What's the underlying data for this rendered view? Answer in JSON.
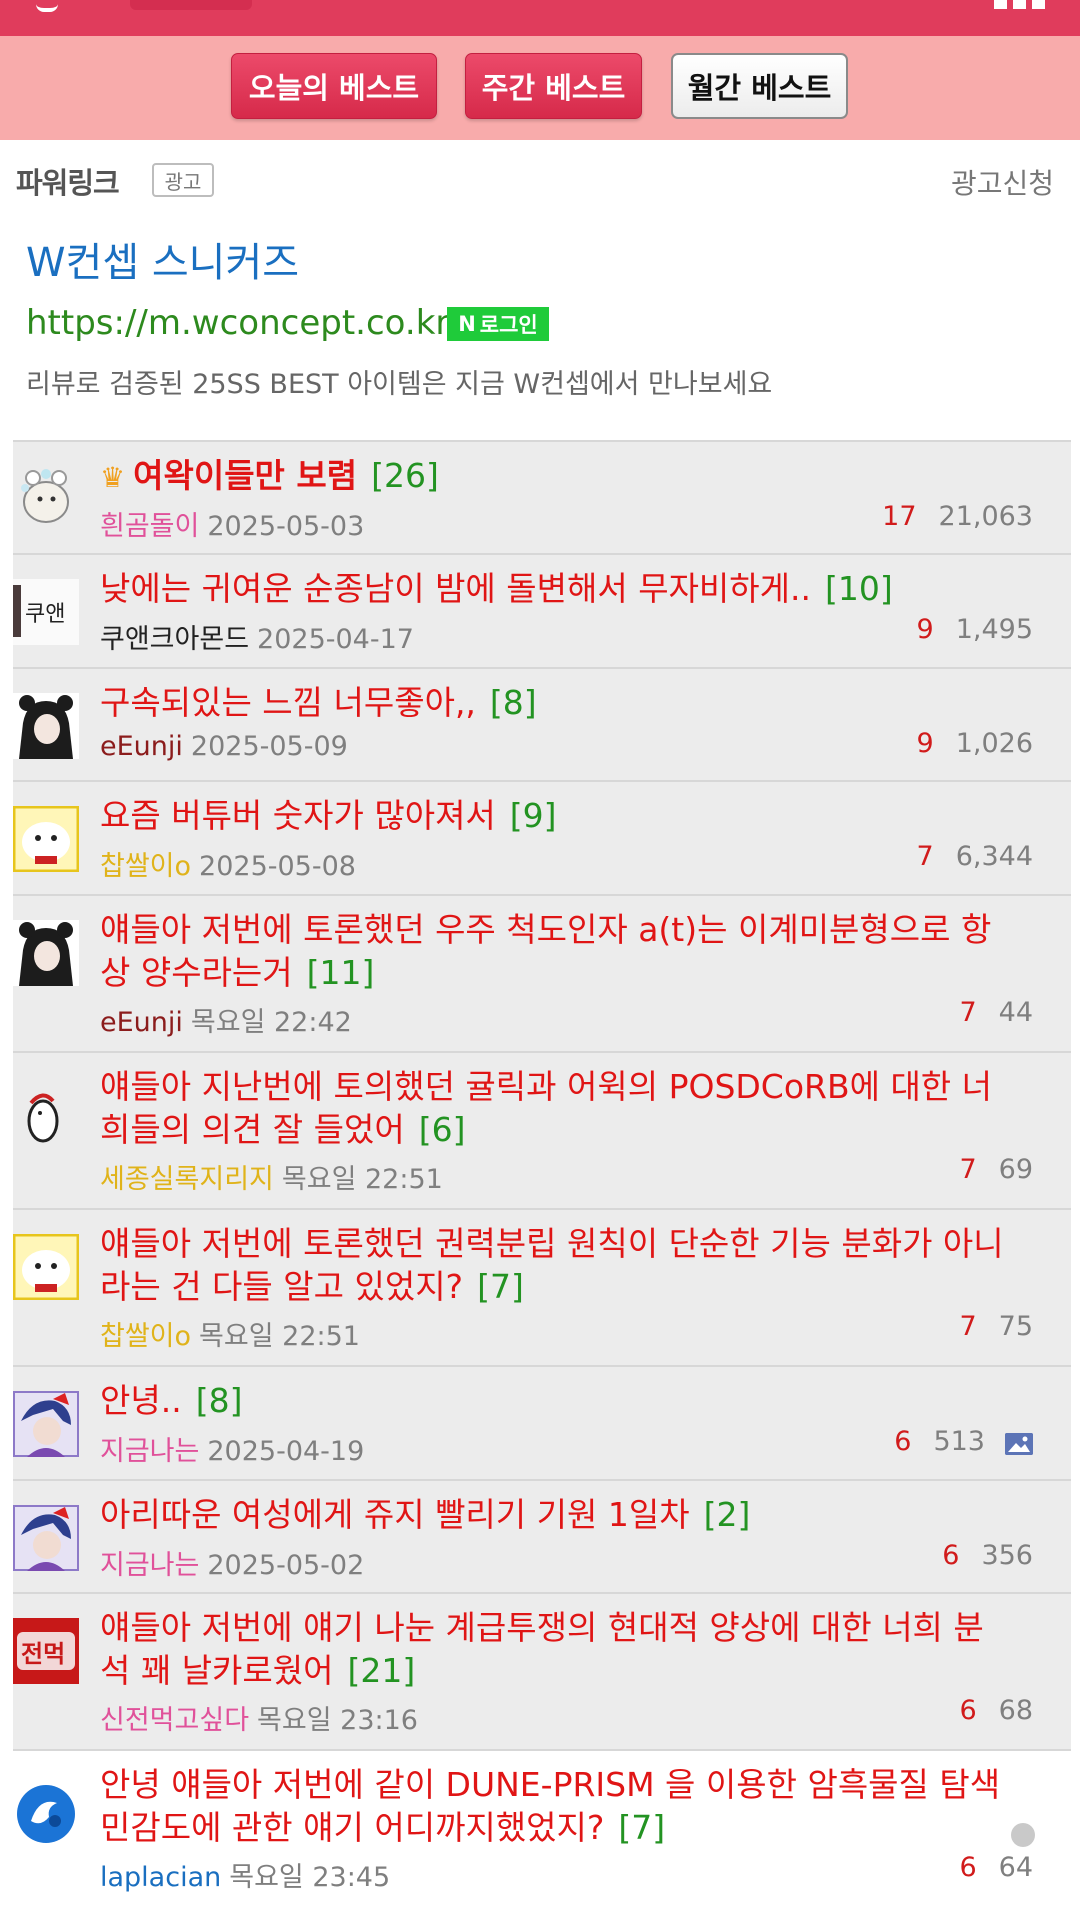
{
  "best_tabs": [
    {
      "label": "오늘의 베스트",
      "active": false
    },
    {
      "label": "주간 베스트",
      "active": false
    },
    {
      "label": "월간 베스트",
      "active": true
    }
  ],
  "ad": {
    "section_label": "파워링크",
    "badge": "광고",
    "apply": "광고신청",
    "title": "W컨셉 스니커즈",
    "url": "https://m.wconcept.co.kr",
    "login_badge": "로그인",
    "login_badge_letter": "N",
    "description": "리뷰로 검증된 25SS BEST 아이템은 지금 W컨셉에서 만나보세요"
  },
  "posts": [
    {
      "title": "여왁이들만 보렴",
      "comments": "[26]",
      "author": "흰곰돌이",
      "author_color": "#e0519a",
      "date": "2025-05-03",
      "votes": "17",
      "views": "21,063",
      "crown": true
    },
    {
      "title": "낮에는 귀여운 순종남이 밤에 돌변해서 무자비하게..",
      "comments": "[10]",
      "author": "쿠앤크아몬드",
      "author_color": "#222222",
      "date": "2025-04-17",
      "votes": "9",
      "views": "1,495"
    },
    {
      "title": "구속되있는 느낌 너무좋아,,",
      "comments": "[8]",
      "author": "eEunji",
      "author_color": "#8b1c1c",
      "date": "2025-05-09",
      "votes": "9",
      "views": "1,026"
    },
    {
      "title": "요즘 버튜버 숫자가 많아져서",
      "comments": "[9]",
      "author": "찹쌀이o",
      "author_color": "#e0b31a",
      "date": "2025-05-08",
      "votes": "7",
      "views": "6,344"
    },
    {
      "title": "얘들아 저번에 토론했던 우주 척도인자 a(t)는 이계미분형으로 항상 양수라는거",
      "comments": "[11]",
      "author": "eEunji",
      "author_color": "#8b1c1c",
      "date": "목요일 22:42",
      "votes": "7",
      "views": "44"
    },
    {
      "title": "얘들아 지난번에 토의했던 귤릭과 어윅의 POSDCoRB에 대한 너희들의 의견 잘 들었어",
      "comments": "[6]",
      "author": "세종실록지리지",
      "author_color": "#e0b31a",
      "date": "목요일 22:51",
      "votes": "7",
      "views": "69"
    },
    {
      "title": "얘들아 저번에 토론했던 권력분립 원칙이 단순한 기능 분화가 아니라는 건 다들 알고 있었지?",
      "comments": "[7]",
      "author": "찹쌀이o",
      "author_color": "#e0b31a",
      "date": "목요일 22:51",
      "votes": "7",
      "views": "75"
    },
    {
      "title": "안녕..",
      "comments": "[8]",
      "author": "지금나는",
      "author_color": "#e0519a",
      "date": "2025-04-19",
      "votes": "6",
      "views": "513",
      "has_image": true
    },
    {
      "title": "아리따운 여성에게 쥬지 빨리기 기원 1일차",
      "comments": "[2]",
      "author": "지금나는",
      "author_color": "#e0519a",
      "date": "2025-05-02",
      "votes": "6",
      "views": "356"
    },
    {
      "title": "얘들아 저번에 얘기 나눈 계급투쟁의 현대적 양상에 대한 너희 분석 꽤 날카로웠어",
      "comments": "[21]",
      "author": "신전먹고싶다",
      "author_color": "#e0519a",
      "date": "목요일 23:16",
      "votes": "6",
      "views": "68"
    },
    {
      "title": "안녕 얘들아 저번에 같이 DUNE-PRISM 을 이용한 암흑물질 탐색 민감도에 관한 얘기 어디까지했었지?",
      "comments": "[7]",
      "author": "laplacian",
      "author_color": "#1a6fc0",
      "date": "목요일 23:45",
      "votes": "6",
      "views": "64",
      "has_dot": true
    }
  ]
}
